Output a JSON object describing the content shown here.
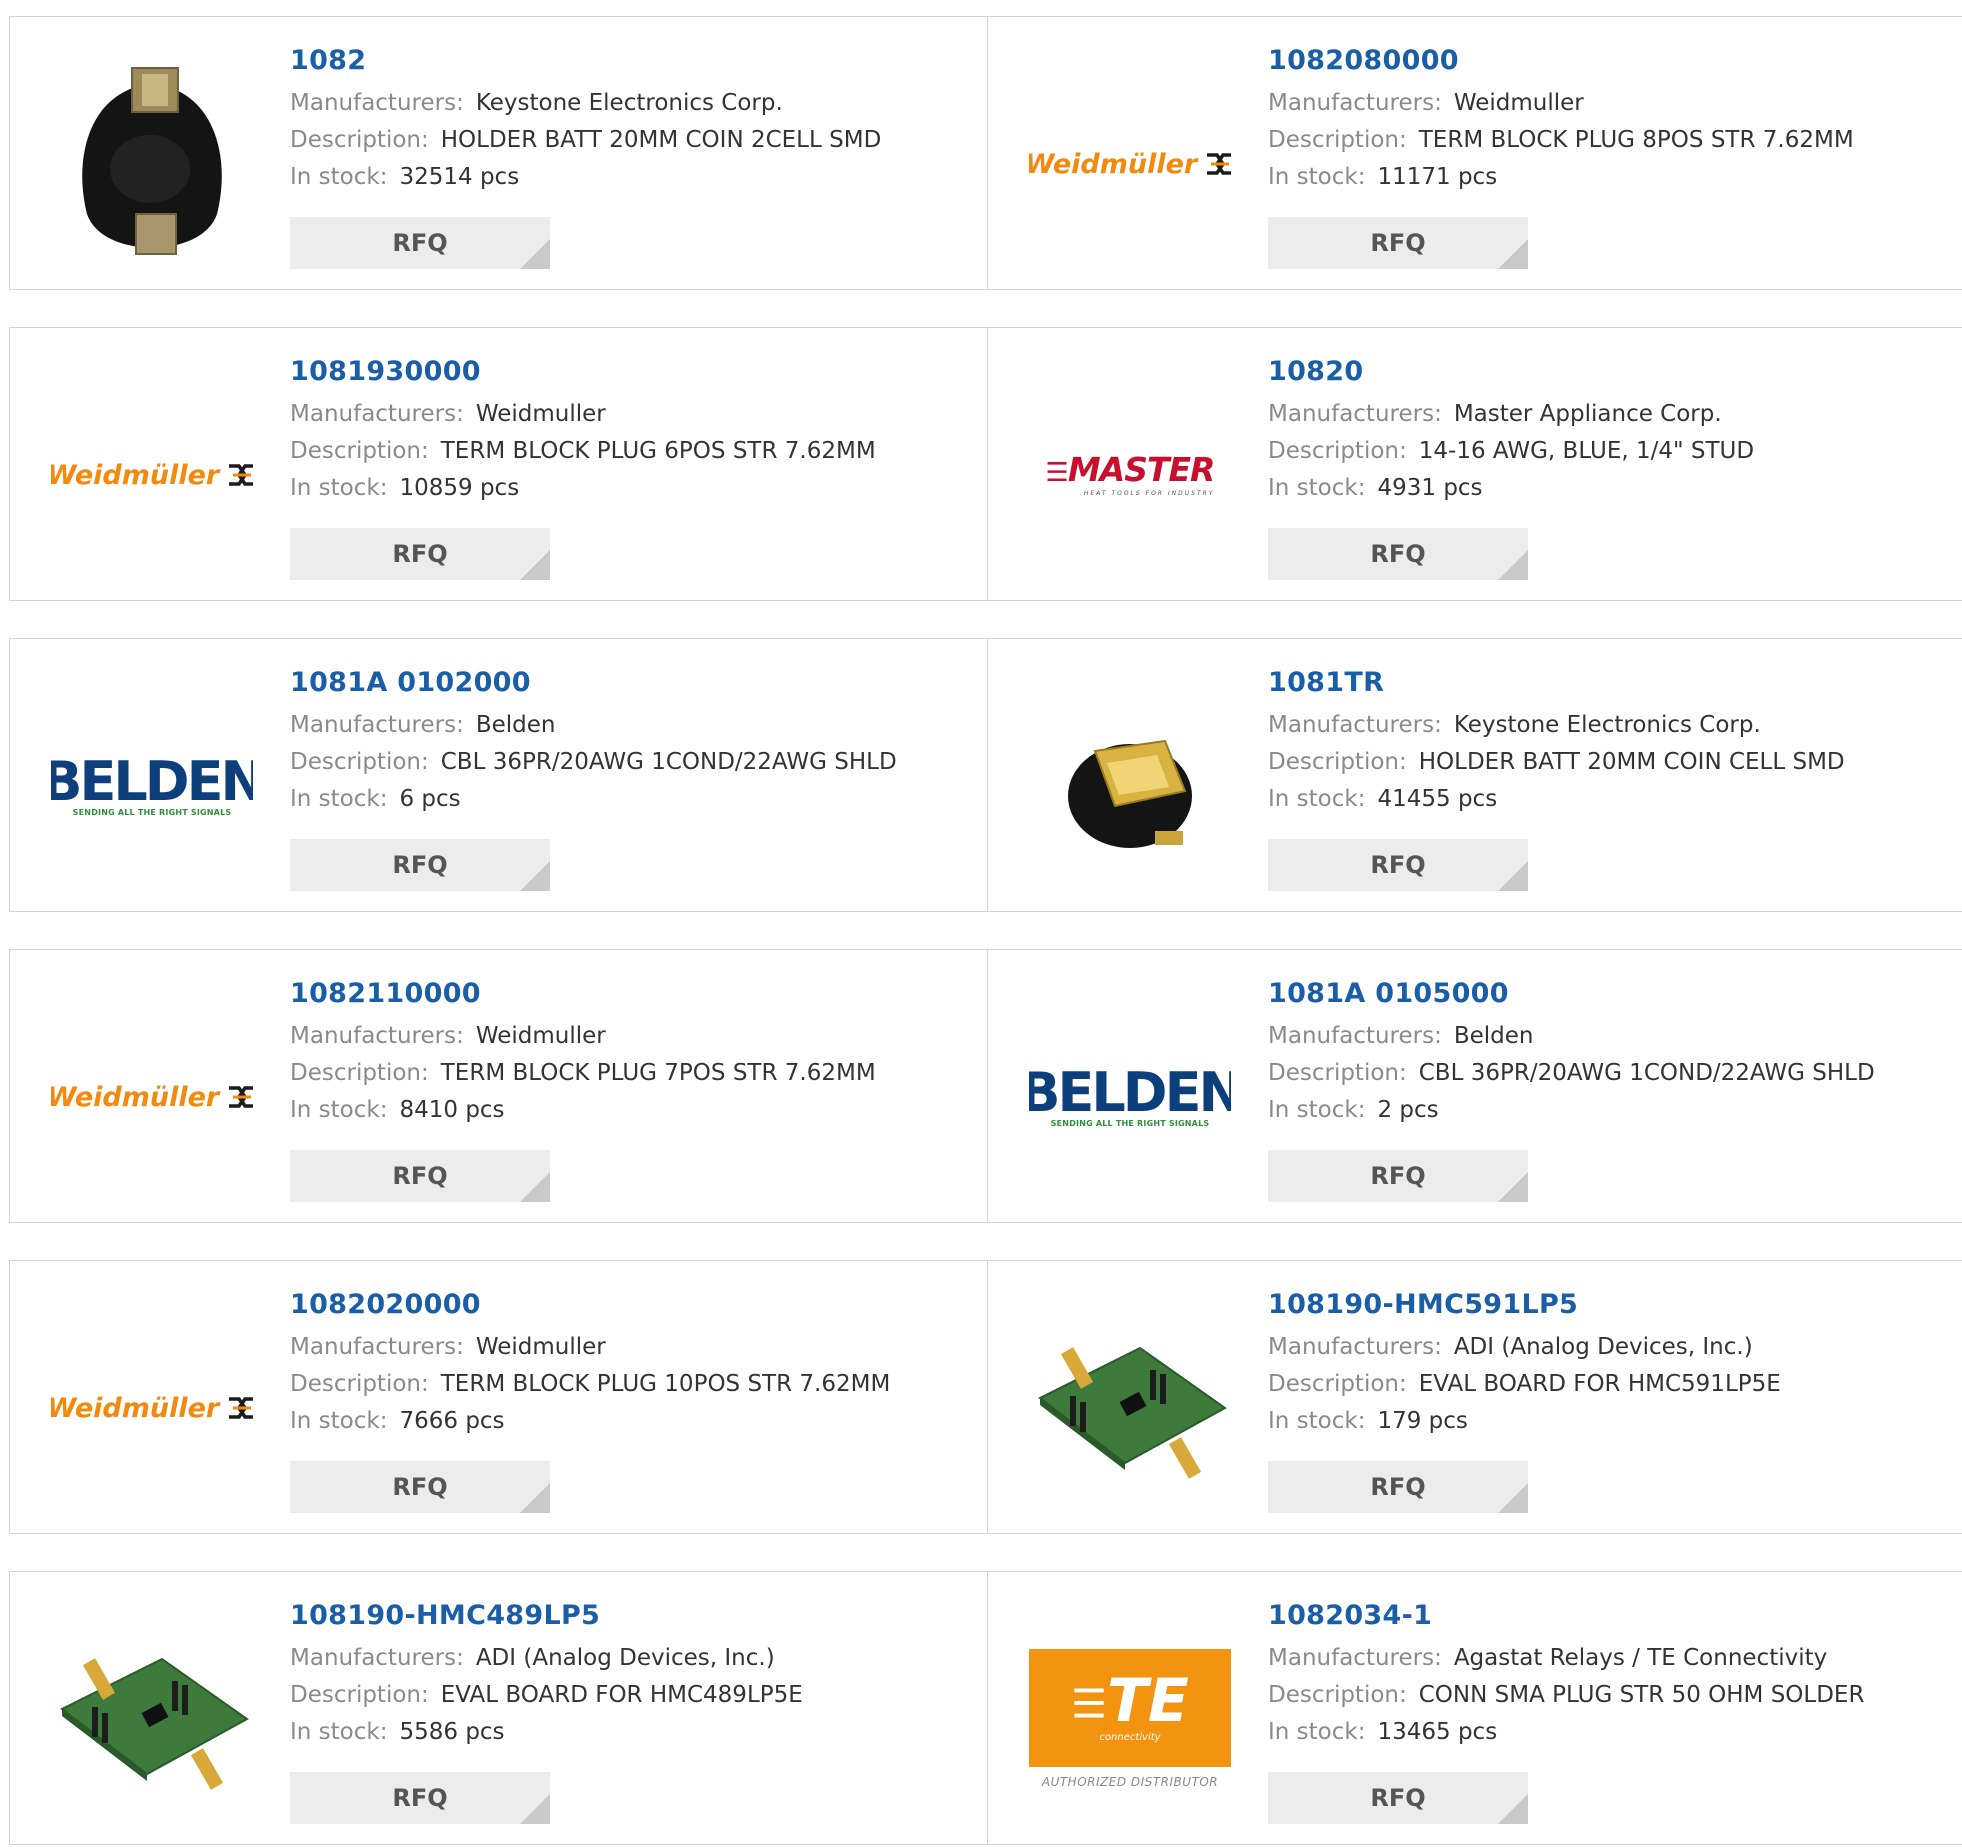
{
  "labels": {
    "manufacturers": "Manufacturers:",
    "description": "Description:",
    "in_stock": "In stock:",
    "rfq": "RFQ"
  },
  "logo_text": {
    "weidmuller": "Weidmüller",
    "belden": "BELDEN",
    "belden_tagline": "SENDING ALL THE RIGHT SIGNALS",
    "master": "MASTER",
    "master_tagline": "HEAT TOOLS FOR INDUSTRY",
    "te": "TE",
    "te_sub": "connectivity",
    "te_dist": "AUTHORIZED DISTRIBUTOR"
  },
  "colors": {
    "part_link": "#1a5ea8",
    "weidmuller_orange": "#f18a0f",
    "belden_blue": "#0d3f7c",
    "master_red": "#c8102e",
    "te_orange": "#f29410"
  },
  "products": [
    {
      "part": "1082",
      "manufacturer": "Keystone Electronics Corp.",
      "description": "HOLDER BATT 20MM COIN 2CELL SMD",
      "stock": "32514 pcs",
      "image": "coin-holder-2cell-icon"
    },
    {
      "part": "1082080000",
      "manufacturer": "Weidmuller",
      "description": "TERM BLOCK PLUG 8POS STR 7.62MM",
      "stock": "11171 pcs",
      "image": "weidmuller-logo"
    },
    {
      "part": "1081930000",
      "manufacturer": "Weidmuller",
      "description": "TERM BLOCK PLUG 6POS STR 7.62MM",
      "stock": "10859 pcs",
      "image": "weidmuller-logo"
    },
    {
      "part": "10820",
      "manufacturer": "Master Appliance Corp.",
      "description": "14-16 AWG, BLUE, 1/4\" STUD",
      "stock": "4931 pcs",
      "image": "master-logo"
    },
    {
      "part": "1081A 0102000",
      "manufacturer": "Belden",
      "description": "CBL 36PR/20AWG 1COND/22AWG SHLD",
      "stock": "6 pcs",
      "image": "belden-logo"
    },
    {
      "part": "1081TR",
      "manufacturer": "Keystone Electronics Corp.",
      "description": "HOLDER BATT 20MM COIN CELL SMD",
      "stock": "41455 pcs",
      "image": "coin-holder-icon"
    },
    {
      "part": "1082110000",
      "manufacturer": "Weidmuller",
      "description": "TERM BLOCK PLUG 7POS STR 7.62MM",
      "stock": "8410 pcs",
      "image": "weidmuller-logo"
    },
    {
      "part": "1081A 0105000",
      "manufacturer": "Belden",
      "description": "CBL 36PR/20AWG 1COND/22AWG SHLD",
      "stock": "2 pcs",
      "image": "belden-logo"
    },
    {
      "part": "1082020000",
      "manufacturer": "Weidmuller",
      "description": "TERM BLOCK PLUG 10POS STR 7.62MM",
      "stock": "7666 pcs",
      "image": "weidmuller-logo"
    },
    {
      "part": "108190-HMC591LP5",
      "manufacturer": "ADI (Analog Devices, Inc.)",
      "description": "EVAL BOARD FOR HMC591LP5E",
      "stock": "179 pcs",
      "image": "eval-board-icon"
    },
    {
      "part": "108190-HMC489LP5",
      "manufacturer": "ADI (Analog Devices, Inc.)",
      "description": "EVAL BOARD FOR HMC489LP5E",
      "stock": "5586 pcs",
      "image": "eval-board-icon"
    },
    {
      "part": "1082034-1",
      "manufacturer": "Agastat Relays / TE Connectivity",
      "description": "CONN SMA PLUG STR 50 OHM SOLDER",
      "stock": "13465 pcs",
      "image": "te-logo"
    }
  ]
}
